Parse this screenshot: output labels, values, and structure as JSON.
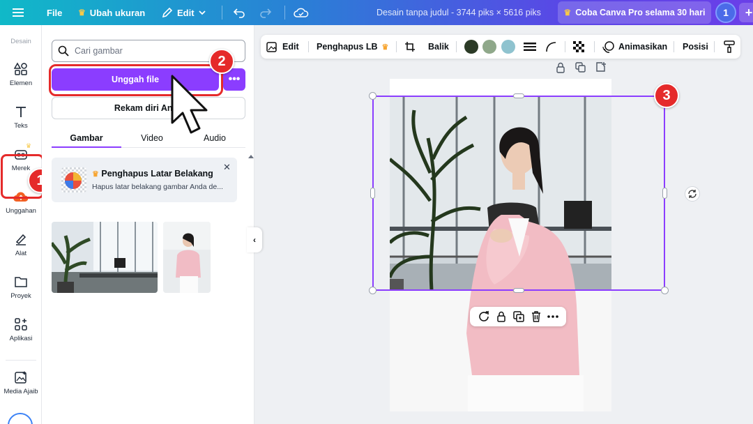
{
  "topbar": {
    "file_label": "File",
    "resize_label": "Ubah ukuran",
    "edit_label": "Edit",
    "document_title": "Desain tanpa judul - 3744 piks × 5616 piks",
    "pro_cta": "Coba Canva Pro selama 30 hari",
    "avatar_initial": "1",
    "plus": "+"
  },
  "rail": {
    "section_label": "Desain",
    "items": [
      {
        "label": "Elemen",
        "icon": "elements-icon"
      },
      {
        "label": "Teks",
        "icon": "text-icon"
      },
      {
        "label": "Merek",
        "icon": "brand-icon"
      },
      {
        "label": "Unggahan",
        "icon": "upload-cloud-icon"
      },
      {
        "label": "Alat",
        "icon": "draw-tools-icon"
      },
      {
        "label": "Proyek",
        "icon": "folder-icon"
      },
      {
        "label": "Aplikasi",
        "icon": "apps-icon"
      },
      {
        "label": "Media Ajaib",
        "icon": "magic-media-icon"
      }
    ]
  },
  "panel": {
    "search_placeholder": "Cari gambar",
    "upload_button": "Unggah file",
    "more_button": "•••",
    "record_button": "Rekam diri Anda",
    "tabs": [
      "Gambar",
      "Video",
      "Audio"
    ],
    "active_tab": "Gambar",
    "promo": {
      "title": "Penghapus Latar Belakang",
      "subtitle": "Hapus latar belakang gambar Anda de...",
      "close": "✕"
    }
  },
  "context_toolbar": {
    "edit": "Edit",
    "bg_remover": "Penghapus LB",
    "flip": "Balik",
    "colors": [
      "#2b3a26",
      "#8fa88a",
      "#8fc3cf"
    ],
    "animate": "Animasikan",
    "position": "Posisi"
  },
  "annotations": {
    "step1": "1",
    "step2": "2",
    "step3": "3"
  },
  "colors": {
    "accent": "#8b3dff",
    "annotation_red": "#e52a2a"
  }
}
